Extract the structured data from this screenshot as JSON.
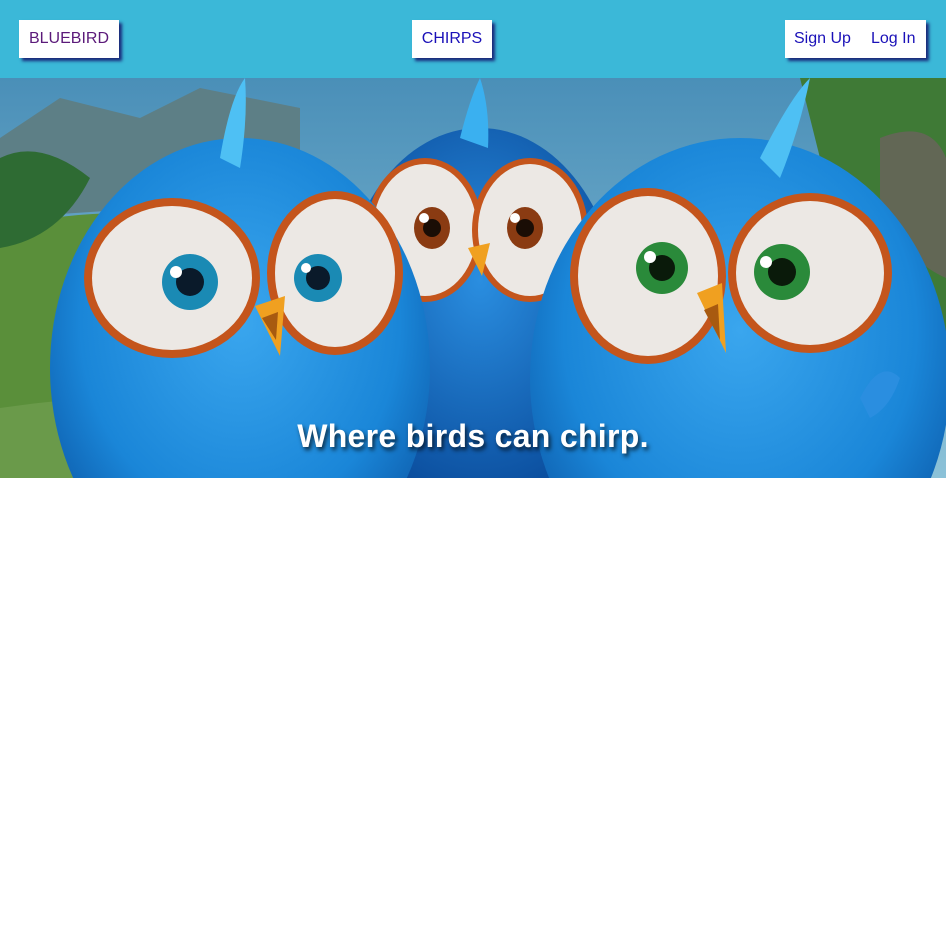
{
  "header": {
    "brand_label": "BLUEBIRD",
    "chirps_label": "CHIRPS",
    "signup_label": "Sign Up",
    "login_label": "Log In",
    "background_color": "#3bb8d8"
  },
  "hero": {
    "tagline": "Where birds can chirp.",
    "image_subject": "three fluffy blue cartoon birds"
  }
}
